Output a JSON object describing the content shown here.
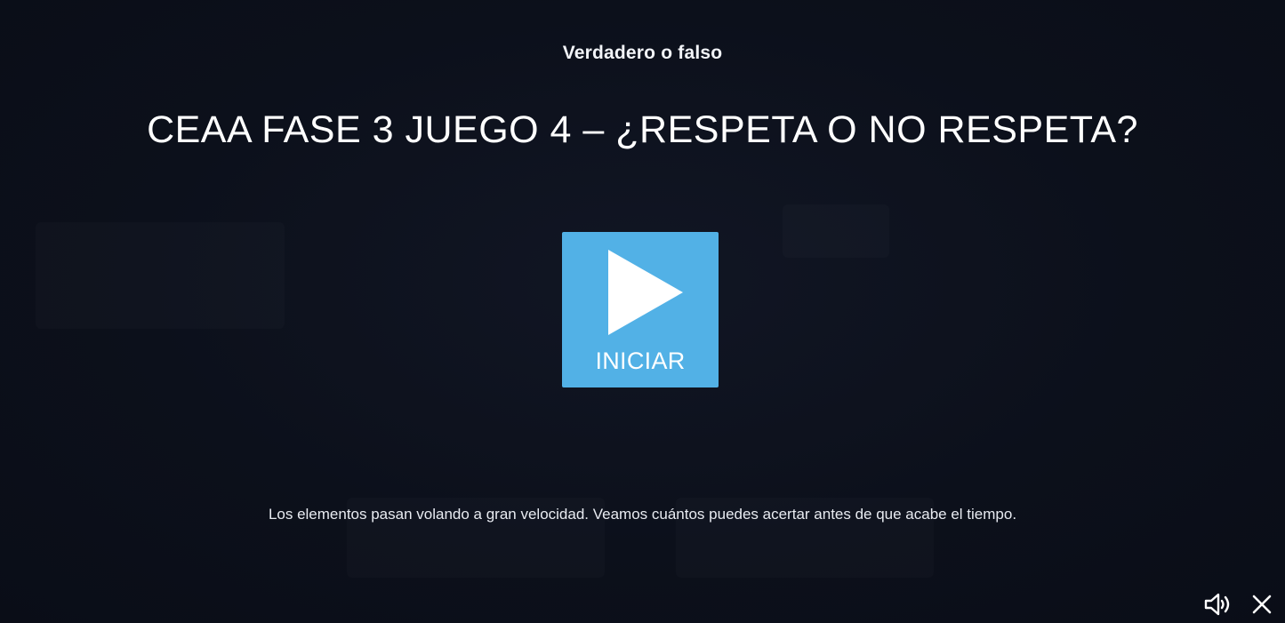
{
  "game": {
    "type_label": "Verdadero o falso",
    "title": "CEAA FASE 3 JUEGO 4 – ¿RESPETA O NO RESPETA?",
    "description": "Los elementos pasan volando a gran velocidad. Veamos cuántos puedes acertar antes de que acabe el tiempo."
  },
  "start_button": {
    "label": "INICIAR",
    "icon": "play-icon",
    "color": "#52b1e6"
  },
  "controls": {
    "sound_icon": "speaker-volume-icon",
    "close_icon": "close-icon"
  },
  "colors": {
    "background": "#0b0f1a",
    "text": "#ffffff"
  }
}
